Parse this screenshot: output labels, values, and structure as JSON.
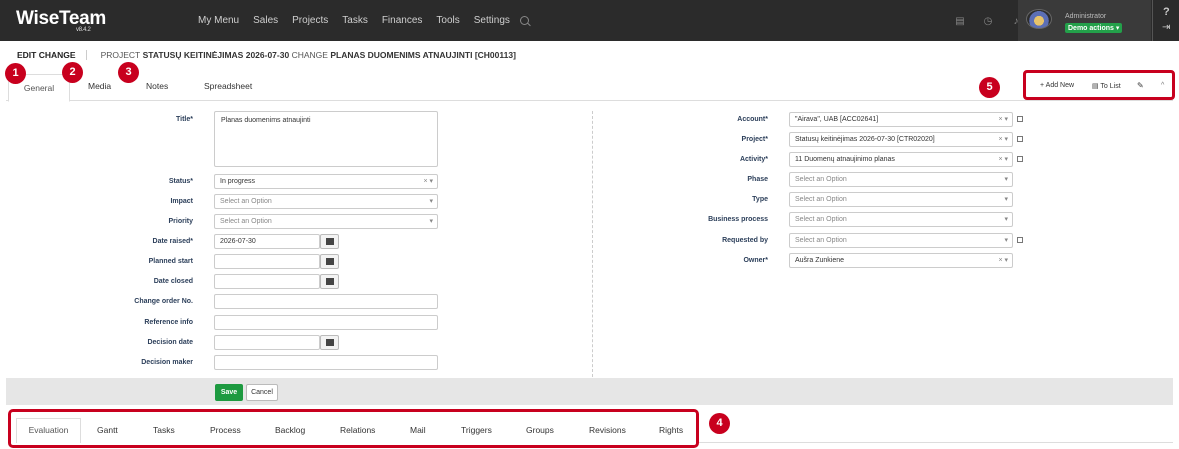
{
  "app": {
    "logo": "WiseTeam",
    "version": "v8.4.2"
  },
  "nav": [
    "My Menu",
    "Sales",
    "Projects",
    "Tasks",
    "Finances",
    "Tools",
    "Settings"
  ],
  "user": {
    "role": "Administrator",
    "demo_label": "Demo actions ▾"
  },
  "help": {
    "q": "?",
    "logout": "⇥"
  },
  "breadcrumb": {
    "edit": "EDIT CHANGE",
    "project_prefix": "PROJECT",
    "project_name": "STATUSŲ KEITINĖJIMAS 2026-07-30",
    "change_prefix": "CHANGE",
    "change_name": "PLANAS DUOMENIMS ATNAUJINTI [CH00113]"
  },
  "tabs": [
    "General",
    "Media",
    "Notes",
    "Spreadsheet"
  ],
  "actions": {
    "add": "+ Add New",
    "list": "▤ To List",
    "edit": "✎",
    "collapse": "^"
  },
  "markers": [
    "1",
    "2",
    "3",
    "4",
    "5"
  ],
  "left_form": {
    "title_label": "Title*",
    "title_value": "Planas duomenims atnaujinti",
    "status_label": "Status*",
    "status_value": "In progress",
    "impact_label": "Impact",
    "priority_label": "Priority",
    "placeholder": "Select an Option",
    "date_raised_label": "Date raised*",
    "date_raised_value": "2026-07-30",
    "planned_start_label": "Planned start",
    "date_closed_label": "Date closed",
    "change_order_label": "Change order No.",
    "reference_label": "Reference info",
    "decision_date_label": "Decision date",
    "decision_maker_label": "Decision maker"
  },
  "right_form": {
    "account_label": "Account*",
    "account_value": "\"Airava\", UAB [ACC02641]",
    "project_label": "Project*",
    "project_value": "Statusų keitinėjimas 2026-07-30 [CTR02020]",
    "activity_label": "Activity*",
    "activity_value": "11 Duomenų atnaujinimo planas",
    "phase_label": "Phase",
    "type_label": "Type",
    "business_label": "Business process",
    "requested_label": "Requested by",
    "owner_label": "Owner*",
    "owner_value": "Aušra Zunkiene"
  },
  "buttons": {
    "save": "Save",
    "cancel": "Cancel"
  },
  "bottom_tabs": [
    "Evaluation",
    "Gantt",
    "Tasks",
    "Process",
    "Backlog",
    "Relations",
    "Mail",
    "Triggers",
    "Groups",
    "Revisions",
    "Rights"
  ]
}
